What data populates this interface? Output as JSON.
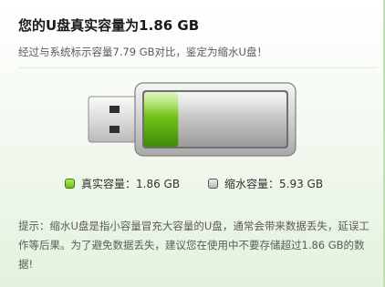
{
  "dialog": {
    "title": "您的U盘真实容量为1.86 GB",
    "subtitle": "经过与系统标示容量7.79 GB对比，鉴定为缩水U盘！"
  },
  "usb_visual": {
    "real_fraction": 0.239,
    "real_color": "#6cbf14",
    "empty_color": "#c4c4c4"
  },
  "legend": {
    "real": {
      "label": "真实容量：1.86 GB",
      "color": "#7ccb1f",
      "icon": "green-square-icon"
    },
    "shrink": {
      "label": "缩水容量：5.93 GB",
      "color": "#c8c8c8",
      "icon": "gray-square-icon"
    }
  },
  "tip": {
    "text": "提示：缩水U盘是指小容量冒充大容量的U盘，通常会带来数据丢失，延误工作等后果。为了避免数据丢失，建议您在使用中不要存储超过1.86 GB的数据!"
  }
}
